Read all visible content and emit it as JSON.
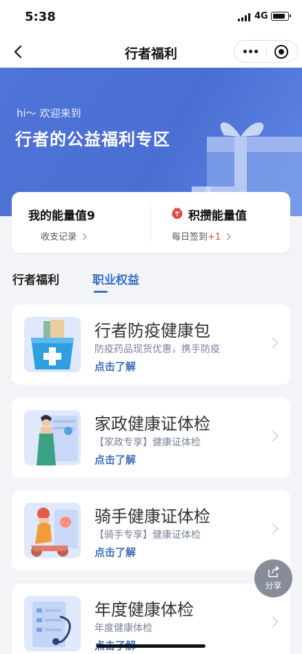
{
  "status": {
    "time": "5:38",
    "network": "4G"
  },
  "nav": {
    "title": "行者福利"
  },
  "banner": {
    "greeting": "hi～ 欢迎来到",
    "title": "行者的公益福利专区"
  },
  "energy": {
    "title": "我的能量值9",
    "records_link": "收支记录",
    "collect_title": "积攒能量值",
    "signin_label": "每日签到",
    "signin_bonus": "+1"
  },
  "tabs": [
    {
      "label": "行者福利",
      "active": false
    },
    {
      "label": "职业权益",
      "active": true
    }
  ],
  "cards": [
    {
      "title": "行者防疫健康包",
      "subtitle": "防疫药品现货优惠，携手防疫",
      "cta": "点击了解",
      "icon": "medicine-bag-icon"
    },
    {
      "title": "家政健康证体检",
      "subtitle": "【家政专享】健康证体检",
      "cta": "点击了解",
      "icon": "housekeeper-icon"
    },
    {
      "title": "骑手健康证体检",
      "subtitle": "【骑手专享】健康证体检",
      "cta": "点击了解",
      "icon": "rider-icon"
    },
    {
      "title": "年度健康体检",
      "subtitle": "年度健康体检",
      "cta": "点击了解",
      "icon": "stethoscope-icon"
    }
  ],
  "share": {
    "label": "分享"
  },
  "colors": {
    "accent": "#3a6fc7",
    "banner": "#4f74d8",
    "bonus": "#e0493f"
  }
}
